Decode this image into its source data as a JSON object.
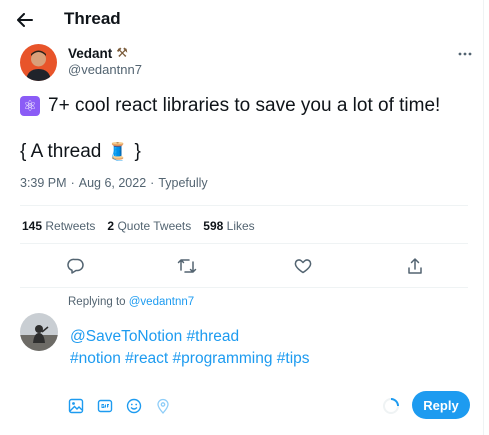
{
  "header": {
    "title": "Thread"
  },
  "author": {
    "name": "Vedant",
    "name_emoji": "⚒",
    "handle": "@vedantnn7"
  },
  "tweet": {
    "line1_emoji": "⚛",
    "line1_text": "7+ cool react libraries to save you a lot of time!",
    "line2_open": "{ A thread",
    "line2_emoji": "🧵",
    "line2_close": "}",
    "time": "3:39 PM",
    "sep1": "·",
    "date": "Aug 6, 2022",
    "sep2": "·",
    "source": "Typefully"
  },
  "stats": [
    {
      "count": "145",
      "label": "Retweets"
    },
    {
      "count": "2",
      "label": "Quote Tweets"
    },
    {
      "count": "598",
      "label": "Likes"
    }
  ],
  "reply": {
    "replying_prefix": "Replying to",
    "replying_handle": "@vedantnn7",
    "line1": "@SaveToNotion #thread",
    "line2": "#notion #react #programming #tips",
    "button_label": "Reply"
  },
  "colors": {
    "accent": "#1d9bf0",
    "text": "#0f1419",
    "muted": "#536471",
    "divider": "#eff3f4"
  },
  "icons": [
    "back-arrow-icon",
    "more-icon",
    "reply-icon",
    "retweet-icon",
    "like-icon",
    "share-icon",
    "image-icon",
    "gif-icon",
    "emoji-icon",
    "location-icon"
  ]
}
